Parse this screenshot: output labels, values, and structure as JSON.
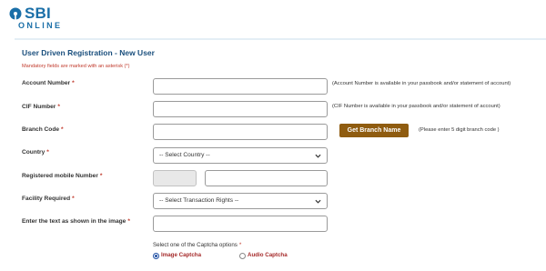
{
  "brand": {
    "name": "SBI",
    "tagline": "ONLINE",
    "color": "#1a6fa8"
  },
  "form": {
    "title": "User Driven Registration - New User",
    "mandatory_note": "Mandatory fields are marked with an asterisk (*)",
    "required_marker": "*",
    "account_number": {
      "label": "Account Number",
      "value": "",
      "hint": "(Account Number is available in your passbook and/or statement of account)"
    },
    "cif_number": {
      "label": "CIF Number",
      "value": "",
      "hint": "(CIF Number is available in your passbook and/or statement of account)"
    },
    "branch_code": {
      "label": "Branch Code",
      "value": "",
      "button_label": "Get Branch Name",
      "hint": "(Please enter 5 digit branch code )"
    },
    "country": {
      "label": "Country",
      "selected": "-- Select Country --"
    },
    "mobile": {
      "label": "Registered mobile Number",
      "country_code": "",
      "value": ""
    },
    "facility": {
      "label": "Facility Required",
      "selected": "-- Select Transaction Rights --"
    },
    "captcha_text": {
      "label": "Enter the text as shown in the image",
      "value": ""
    },
    "captcha_option": {
      "prompt": "Select one of the Captcha options",
      "options": [
        {
          "label": "Image Captcha",
          "checked": true
        },
        {
          "label": "Audio Captcha",
          "checked": false
        }
      ]
    }
  },
  "colors": {
    "title": "#1a4f7d",
    "required": "#c0392b",
    "button": "#8f5c10",
    "radio_label": "#a52a2a"
  }
}
